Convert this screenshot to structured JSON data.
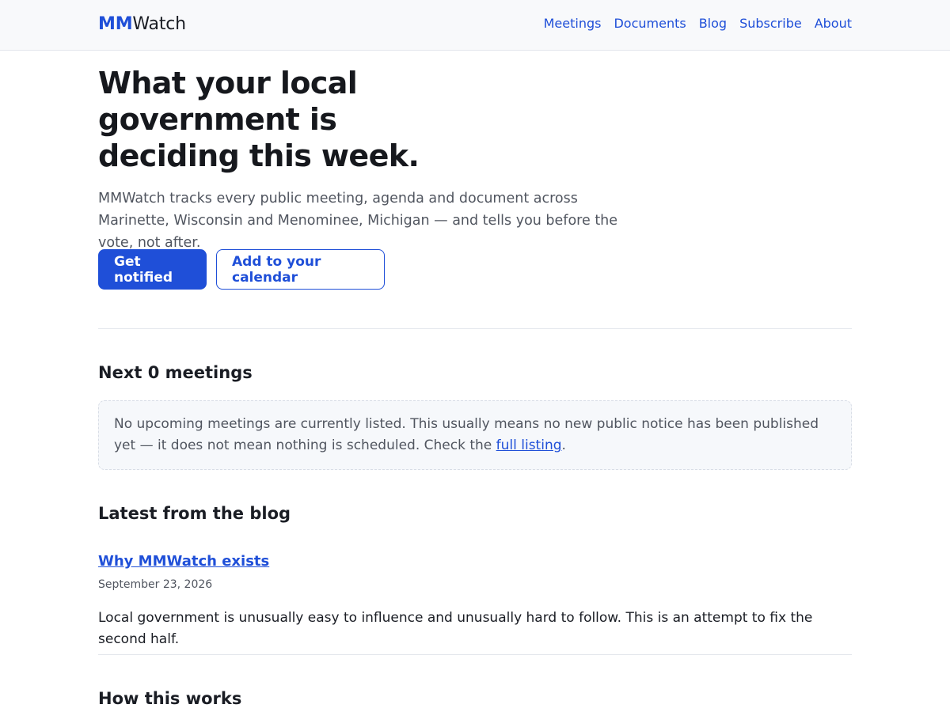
{
  "header": {
    "brand_accent": "MM",
    "brand_rest": "Watch",
    "nav": [
      "Meetings",
      "Documents",
      "Blog",
      "Subscribe",
      "About"
    ]
  },
  "hero": {
    "title": "What your local government is deciding this week.",
    "subtitle": "MMWatch tracks every public meeting, agenda and document across Marinette, Wisconsin and Menominee, Michigan — and tells you before the vote, not after.",
    "primary_cta": "Get notified",
    "secondary_cta": "Add to your calendar"
  },
  "meetings": {
    "heading": "Next 0 meetings",
    "empty_text_before_link": "No upcoming meetings are currently listed. This usually means no new public notice has been published yet — it does not mean nothing is scheduled. Check the ",
    "empty_link": "full listing",
    "empty_text_after_link": "."
  },
  "blog": {
    "heading": "Latest from the blog",
    "posts": [
      {
        "title": "Why MMWatch exists",
        "date": "September 23, 2026",
        "excerpt": "Local government is unusually easy to influence and unusually hard to follow. This is an attempt to fix the second half."
      }
    ]
  },
  "how": {
    "heading": "How this works"
  },
  "colors": {
    "accent": "#1f4fd8",
    "text": "#1a1d24",
    "muted": "#50555f",
    "border": "#e3e6ec"
  }
}
